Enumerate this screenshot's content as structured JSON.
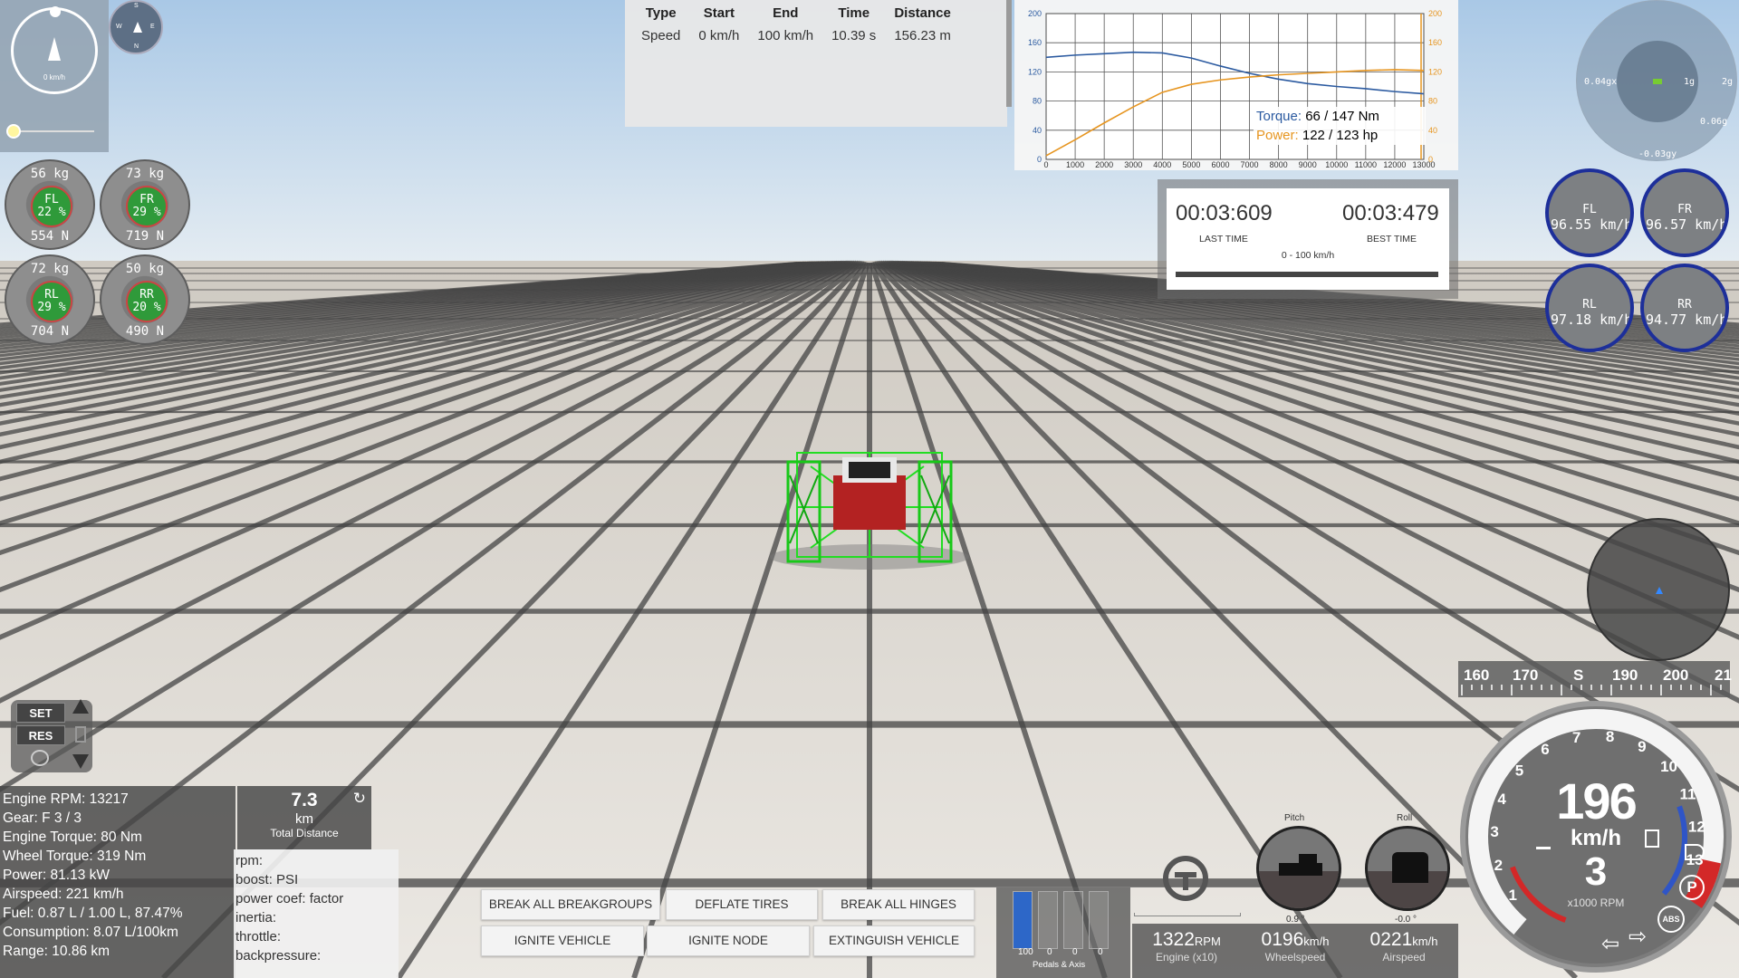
{
  "compass": {
    "speed_label": "0 km/h",
    "mini_letters": [
      "S",
      "E",
      "W",
      "N"
    ]
  },
  "tires": [
    {
      "pos": "FL",
      "kg": "56 kg",
      "pct": "22 %",
      "n": "554 N"
    },
    {
      "pos": "FR",
      "kg": "73 kg",
      "pct": "29 %",
      "n": "719 N"
    },
    {
      "pos": "RL",
      "kg": "72 kg",
      "pct": "29 %",
      "n": "704 N"
    },
    {
      "pos": "RR",
      "kg": "50 kg",
      "pct": "20 %",
      "n": "490 N"
    }
  ],
  "measure_table": {
    "headers": [
      "Type",
      "Start",
      "End",
      "Time",
      "Distance"
    ],
    "row": [
      "Speed",
      "0 km/h",
      "100 km/h",
      "10.39 s",
      "156.23 m"
    ]
  },
  "chart_data": {
    "type": "line",
    "x": [
      0,
      1000,
      2000,
      3000,
      4000,
      5000,
      6000,
      7000,
      8000,
      9000,
      10000,
      11000,
      12000,
      13000
    ],
    "x_ticks": [
      "0",
      "1000",
      "2000",
      "3000",
      "4000",
      "5000",
      "6000",
      "7000",
      "8000",
      "9000",
      "10000",
      "11000",
      "12000",
      "13000"
    ],
    "left_ticks": [
      "200",
      "160",
      "120",
      "80",
      "40",
      "0"
    ],
    "right_ticks": [
      "200",
      "160",
      "120",
      "80",
      "40",
      "0"
    ],
    "ylim": [
      0,
      200
    ],
    "series": [
      {
        "color": "#2b5aa0",
        "values": [
          140,
          143,
          145,
          147,
          146,
          139,
          128,
          118,
          110,
          104,
          100,
          97,
          93,
          90
        ]
      },
      {
        "color": "#e69520",
        "values": [
          5,
          27,
          50,
          72,
          92,
          103,
          109,
          113,
          116,
          118,
          120,
          122,
          123,
          122
        ]
      }
    ],
    "legend": [
      {
        "label": "Torque:",
        "value": "66 / 147 Nm",
        "color": "#2b5aa0"
      },
      {
        "label": "Power:",
        "value": "122 / 123 hp",
        "color": "#e69520"
      }
    ]
  },
  "timer": {
    "last_time": "00:03:609",
    "last_label": "LAST TIME",
    "best_time": "00:03:479",
    "best_label": "BEST TIME",
    "range": "0 - 100 km/h"
  },
  "gforce": {
    "left": "0.04gx",
    "mid": "1g",
    "right": "2g",
    "r2": "0.06g",
    "bottom": "-0.03gy"
  },
  "wheel_speeds": [
    {
      "pos": "FL",
      "val": "96.55 km/h"
    },
    {
      "pos": "FR",
      "val": "96.57 km/h"
    },
    {
      "pos": "RL",
      "val": "97.18 km/h"
    },
    {
      "pos": "RR",
      "val": "94.77 km/h"
    }
  ],
  "cruise": {
    "set": "SET",
    "res": "RES"
  },
  "stats": [
    "Engine RPM: 13217",
    "Gear: F 3 / 3",
    "Engine Torque: 80 Nm",
    "Wheel Torque: 319 Nm",
    "Power: 81.13 kW",
    "Airspeed: 221 km/h",
    "Fuel: 0.87 L / 1.00 L, 87.47%",
    "Consumption: 8.07 L/100km",
    "Range: 10.86 km"
  ],
  "distance": {
    "value": "7.3",
    "unit": "km",
    "label": "Total Distance"
  },
  "engine_map": [
    "rpm:",
    "boost: PSI",
    "power coef: factor",
    "inertia:",
    "throttle:",
    "backpressure:"
  ],
  "buttons": {
    "break_groups": "BREAK ALL BREAKGROUPS",
    "deflate": "DEFLATE TIRES",
    "break_hinges": "BREAK ALL HINGES",
    "ignite_vehicle": "IGNITE VEHICLE",
    "ignite_node": "IGNITE NODE",
    "extinguish": "EXTINGUISH VEHICLE"
  },
  "pedals": {
    "values": [
      "100",
      "0",
      "0",
      "0"
    ],
    "label": "Pedals & Axis",
    "throttle": 1.0
  },
  "readouts": [
    {
      "value": "1322",
      "unit": "RPM",
      "label": "Engine (x10)"
    },
    {
      "value": "0196",
      "unit": "km/h",
      "label": "Wheelspeed"
    },
    {
      "value": "0221",
      "unit": "km/h",
      "label": "Airspeed"
    }
  ],
  "attitude": {
    "pitch_label": "Pitch",
    "pitch_value": "0.9 °",
    "roll_label": "Roll",
    "roll_value": "-0.0 °"
  },
  "heading_tape": [
    "160",
    "170",
    "S",
    "190",
    "200",
    "21"
  ],
  "speedo": {
    "speed": "196",
    "unit": "km/h",
    "gear": "3",
    "rpm_label": "x1000 RPM",
    "ticks": [
      "1",
      "2",
      "3",
      "4",
      "5",
      "6",
      "7",
      "8",
      "9",
      "10",
      "11",
      "12",
      "13"
    ],
    "abs": "ABS",
    "park": "P"
  },
  "colors": {
    "accent_green": "#2f9a3a",
    "ring_blue": "#1d2f9a",
    "torque": "#2b5aa0",
    "power": "#e69520"
  }
}
